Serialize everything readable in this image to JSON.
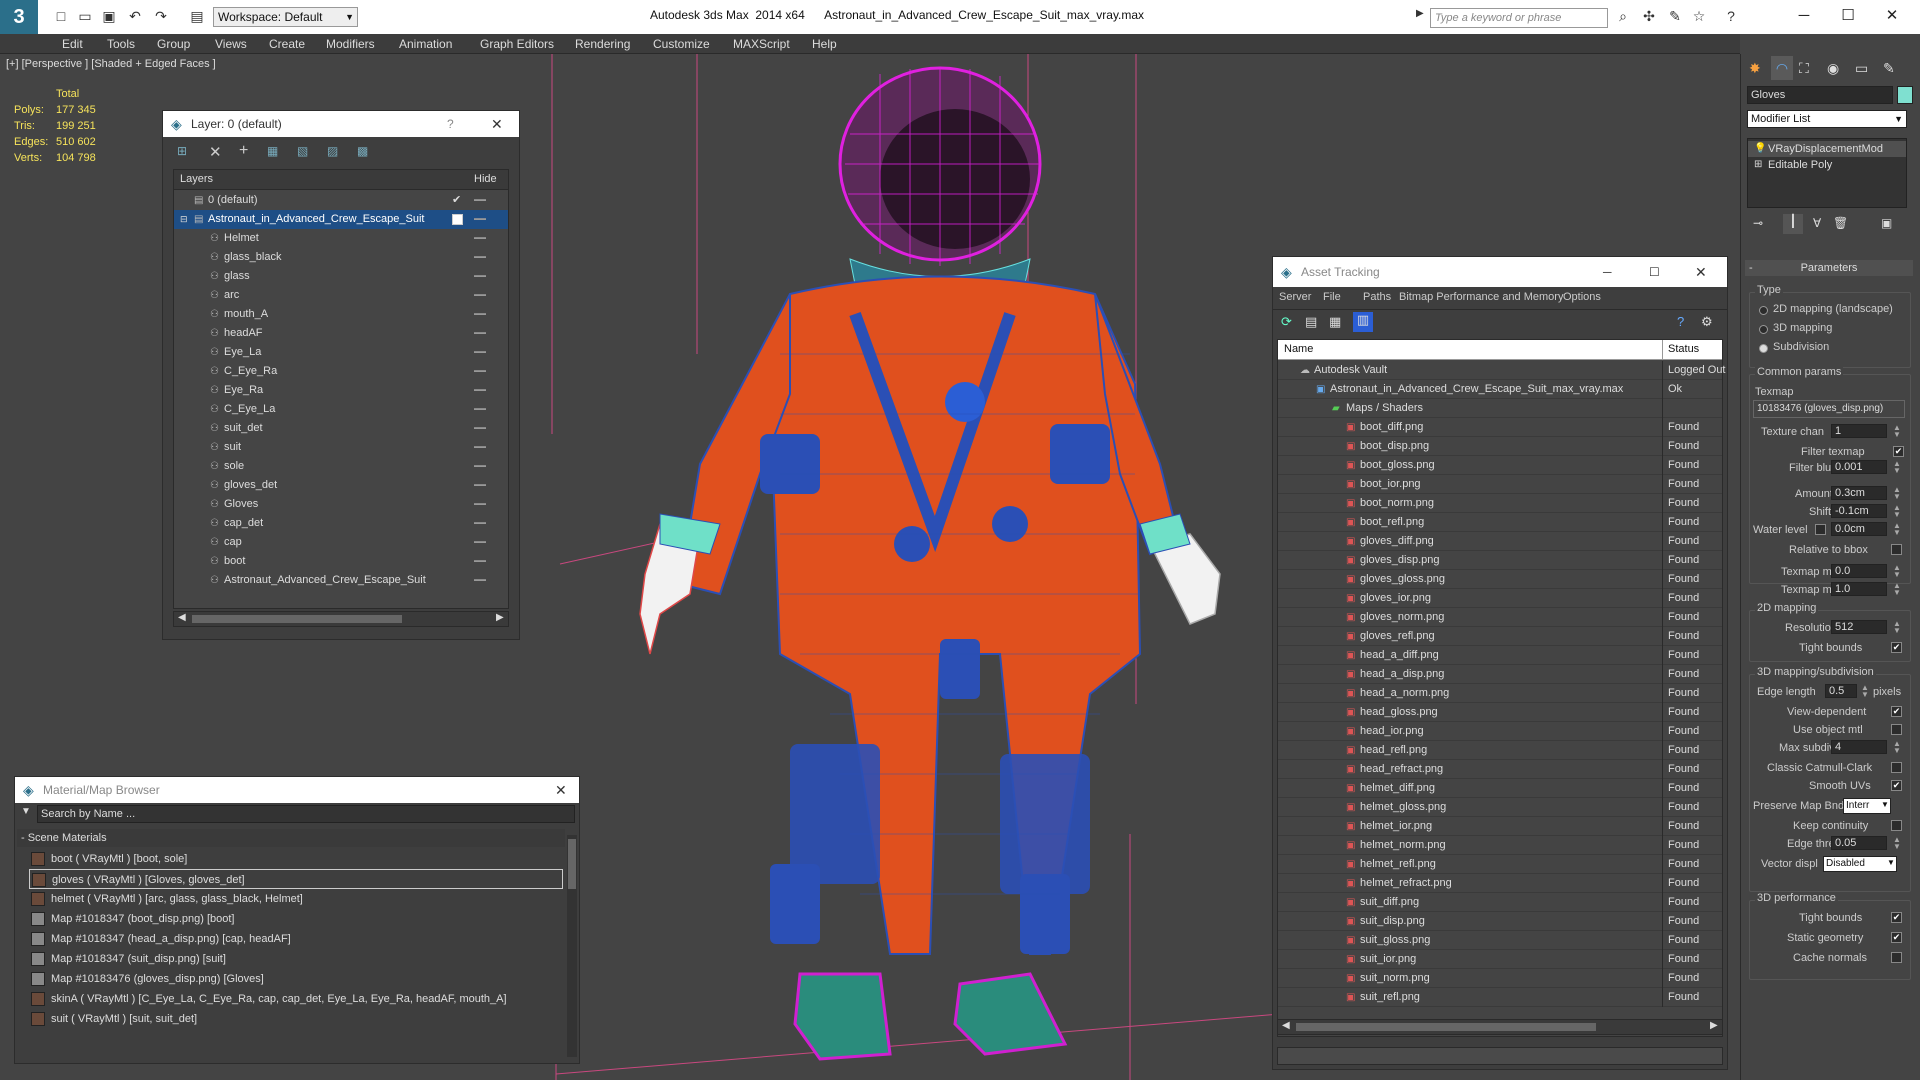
{
  "app": {
    "logo": "3",
    "workspace": "Workspace: Default",
    "title": "Autodesk 3ds Max  2014 x64      Astronaut_in_Advanced_Crew_Escape_Suit_max_vray.max",
    "search_placeholder": "Type a keyword or phrase"
  },
  "menu": [
    "Edit",
    "Tools",
    "Group",
    "Views",
    "Create",
    "Modifiers",
    "Animation",
    "Graph Editors",
    "Rendering",
    "Customize",
    "MAXScript",
    "Help"
  ],
  "viewport": {
    "label": "[+] [Perspective ] [Shaded + Edged Faces ]",
    "stats_header": "Total",
    "stats": [
      {
        "label": "Polys:",
        "value": "177 345"
      },
      {
        "label": "Tris:",
        "value": "199 251"
      },
      {
        "label": "Edges:",
        "value": "510 602"
      },
      {
        "label": "Verts:",
        "value": "104 798"
      }
    ]
  },
  "layer_window": {
    "title": "Layer: 0 (default)",
    "help": "?",
    "col_layers": "Layers",
    "col_hide": "Hide",
    "rows": [
      "0 (default)",
      "Astronaut_in_Advanced_Crew_Escape_Suit",
      "Helmet",
      "glass_black",
      "glass",
      "arc",
      "mouth_A",
      "headAF",
      "Eye_La",
      "C_Eye_Ra",
      "Eye_Ra",
      "C_Eye_La",
      "suit_det",
      "suit",
      "sole",
      "gloves_det",
      "Gloves",
      "cap_det",
      "cap",
      "boot",
      "Astronaut_Advanced_Crew_Escape_Suit"
    ]
  },
  "asset_tracking": {
    "title": "Asset Tracking",
    "menu": [
      "Server",
      "File",
      "Paths",
      "Bitmap Performance and Memory",
      "Options"
    ],
    "col_name": "Name",
    "col_status": "Status",
    "vault": {
      "name": "Autodesk Vault",
      "status": "Logged Out"
    },
    "file": {
      "name": "Astronaut_in_Advanced_Crew_Escape_Suit_max_vray.max",
      "status": "Ok"
    },
    "group": "Maps / Shaders",
    "found_label": "Found",
    "maps": [
      "boot_diff.png",
      "boot_disp.png",
      "boot_gloss.png",
      "boot_ior.png",
      "boot_norm.png",
      "boot_refl.png",
      "gloves_diff.png",
      "gloves_disp.png",
      "gloves_gloss.png",
      "gloves_ior.png",
      "gloves_norm.png",
      "gloves_refl.png",
      "head_a_diff.png",
      "head_a_disp.png",
      "head_a_norm.png",
      "head_gloss.png",
      "head_ior.png",
      "head_refl.png",
      "head_refract.png",
      "helmet_diff.png",
      "helmet_gloss.png",
      "helmet_ior.png",
      "helmet_norm.png",
      "helmet_refl.png",
      "helmet_refract.png",
      "suit_diff.png",
      "suit_disp.png",
      "suit_gloss.png",
      "suit_ior.png",
      "suit_norm.png",
      "suit_refl.png"
    ]
  },
  "material_browser": {
    "title": "Material/Map Browser",
    "search_placeholder": "Search by Name ...",
    "section": "- Scene Materials",
    "items": [
      "boot  ( VRayMtl ) [boot, sole]",
      "gloves  ( VRayMtl ) [Gloves, gloves_det]",
      "helmet  ( VRayMtl ) [arc, glass, glass_black, Helmet]",
      "Map #1018347 (boot_disp.png) [boot]",
      "Map #1018347 (head_a_disp.png) [cap, headAF]",
      "Map #1018347 (suit_disp.png) [suit]",
      "Map #10183476 (gloves_disp.png) [Gloves]",
      "skinA  ( VRayMtl ) [C_Eye_La, C_Eye_Ra, cap, cap_det, Eye_La, Eye_Ra, headAF, mouth_A]",
      "suit  ( VRayMtl ) [suit, suit_det]"
    ]
  },
  "command_panel": {
    "object_name": "Gloves",
    "modifier_list": "Modifier List",
    "stack": [
      "VRayDisplacementMod",
      "Editable Poly"
    ],
    "rollout": "Parameters",
    "type_label": "Type",
    "type_options": [
      "2D mapping (landscape)",
      "3D mapping",
      "Subdivision"
    ],
    "common_params": "Common params",
    "texmap_label": "Texmap",
    "texmap_value": "10183476 (gloves_disp.png)",
    "texture_chan_label": "Texture chan",
    "texture_chan_value": "1",
    "filter_texmap": "Filter texmap",
    "filter_blur_label": "Filter blur",
    "filter_blur_value": "0.001",
    "amount_label": "Amount",
    "amount_value": "0.3cm",
    "shift_label": "Shift",
    "shift_value": "-0.1cm",
    "water_level_label": "Water level",
    "water_level_value": "0.0cm",
    "relative_bbox": "Relative to bbox",
    "texmap_min_label": "Texmap min",
    "texmap_min_value": "0.0",
    "texmap_max_label": "Texmap max",
    "texmap_max_value": "1.0",
    "mapping2d": "2D mapping",
    "resolution_label": "Resolution",
    "resolution_value": "512",
    "tight_bounds": "Tight bounds",
    "mapping3d": "3D mapping/subdivision",
    "edge_length_label": "Edge length",
    "edge_length_value": "0.5",
    "pixels": "pixels",
    "view_dependent": "View-dependent",
    "use_object_mtl": "Use object mtl",
    "max_subdivs_label": "Max subdivs",
    "max_subdivs_value": "4",
    "classic_catmull": "Classic Catmull-Clark",
    "smooth_uvs": "Smooth UVs",
    "preserve_map_label": "Preserve Map Bnd",
    "preserve_map_value": "Interr",
    "keep_continuity": "Keep continuity",
    "edge_thresh_label": "Edge thresh",
    "edge_thresh_value": "0.05",
    "vector_displ_label": "Vector displ",
    "vector_displ_value": "Disabled",
    "perf3d": "3D performance",
    "tight_bounds2": "Tight bounds",
    "static_geometry": "Static geometry",
    "cache_normals": "Cache normals"
  }
}
